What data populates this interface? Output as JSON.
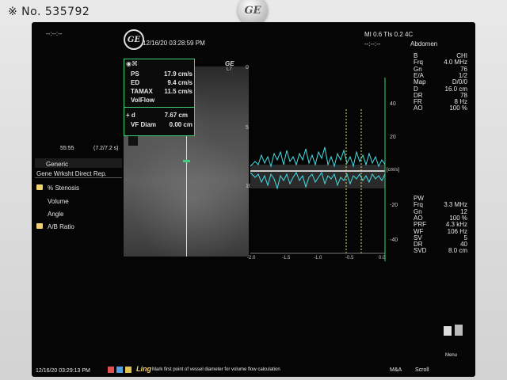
{
  "photo": {
    "caption": "※ No. 535792",
    "bezel_brand": "GE"
  },
  "header": {
    "left_dash": "--:--:--",
    "logo": "GE",
    "datetime": "12/16/20 03:28:59 PM",
    "mi_tis": "MI 0.6    TIs 0.2  4C",
    "right_dash": "--:--:--",
    "preset": "Abdomen"
  },
  "measurements": {
    "header": "◉⌘",
    "rows": [
      {
        "label": "PS",
        "value": "17.9 cm/s"
      },
      {
        "label": "ED",
        "value": "9.4 cm/s"
      },
      {
        "label": "TAMAX",
        "value": "11.5 cm/s"
      },
      {
        "label": "VolFlow",
        "value": ""
      }
    ],
    "rows2": [
      {
        "label": "+ d",
        "value": "7.67 cm"
      },
      {
        "label": "VF Diam",
        "value": "0.00 cm"
      }
    ]
  },
  "probe_label": {
    "line1": "GE",
    "line2": "L7"
  },
  "depth_ticks": [
    "0",
    "5",
    "10"
  ],
  "spectrum": {
    "velocity_ticks": [
      "40",
      "20",
      "-20",
      "-40"
    ],
    "time_ticks": [
      "-2.0",
      "-1.5",
      "-1.0",
      "-0.5",
      "0.0"
    ],
    "unit": "[cm/s]"
  },
  "left_panel": {
    "time_a": "55:55",
    "time_b": "(7.2/7.2 s)",
    "menu": [
      {
        "label": "Generic",
        "folder": false
      },
      {
        "label": "Gene Wrksht  Direct Rep.",
        "folder": false
      },
      {
        "label": "% Stenosis",
        "folder": true
      },
      {
        "label": "Volume",
        "folder": false
      },
      {
        "label": "Angle",
        "folder": false
      },
      {
        "label": "A/B Ratio",
        "folder": true
      }
    ]
  },
  "b_params": [
    {
      "k": "B",
      "v": "CHI"
    },
    {
      "k": "Frq",
      "v": "4.0 MHz"
    },
    {
      "k": "Gn",
      "v": "76"
    },
    {
      "k": "E/A",
      "v": "1/2"
    },
    {
      "k": "Map",
      "v": "D/0/0"
    },
    {
      "k": "D",
      "v": "16.0 cm"
    },
    {
      "k": "DR",
      "v": "78"
    },
    {
      "k": "FR",
      "v": "8 Hz"
    },
    {
      "k": "AO",
      "v": "100 %"
    }
  ],
  "pw_params": [
    {
      "k": "PW",
      "v": ""
    },
    {
      "k": "Frq",
      "v": "3.3 MHz"
    },
    {
      "k": "Gn",
      "v": "12"
    },
    {
      "k": "AO",
      "v": "100 %"
    },
    {
      "k": "PRF",
      "v": "4.3 kHz"
    },
    {
      "k": "WF",
      "v": "106 Hz"
    },
    {
      "k": "SV",
      "v": "5"
    },
    {
      "k": "DR",
      "v": "40"
    },
    {
      "k": "SVD",
      "v": "8.0 cm"
    }
  ],
  "bottom": {
    "datetime": "12/16/20 03:29:13 PM",
    "ling": "Ling",
    "message": "Mark first point of vessel diameter for volume flow calculation",
    "ma": "M&A",
    "scroll": "Scroll",
    "menu": "Menu"
  },
  "colors": {
    "accent_green": "#3bd27b",
    "spectrum_cyan": "#42e0e6",
    "marker_yellow": "#e8e060"
  }
}
